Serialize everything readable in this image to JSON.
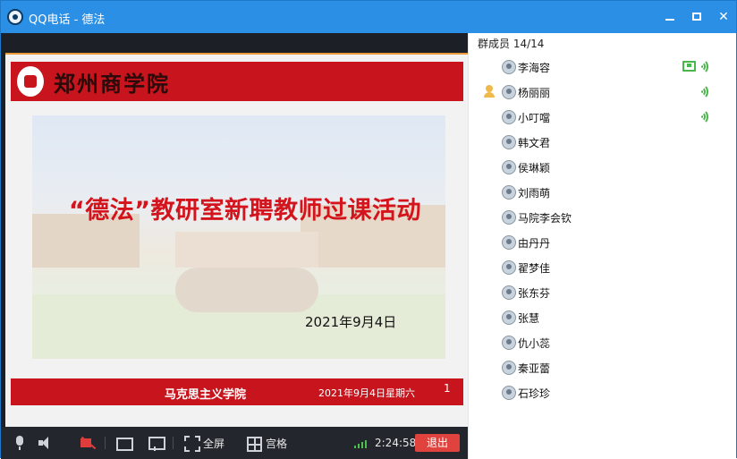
{
  "window": {
    "title": "QQ电话 - 德法"
  },
  "slide": {
    "school_name": "郑州商学院",
    "title": "“德法”教研室新聘教师过课活动",
    "date": "2021年9月4日",
    "footer_department": "马克思主义学院",
    "footer_date": "2021年9月4日星期六",
    "footer_page_mark": "1"
  },
  "toolbar": {
    "fullscreen_label": "全屏",
    "grid_label": "宫格",
    "call_duration": "2:24:58",
    "exit_label": "退出"
  },
  "members_panel": {
    "title": "群成员 14/14",
    "members": [
      {
        "name": "李海容",
        "sharing_screen": true,
        "speaking": true
      },
      {
        "name": "杨丽丽",
        "host": true,
        "speaking": true
      },
      {
        "name": "小叮噹",
        "speaking": true
      },
      {
        "name": "韩文君"
      },
      {
        "name": "侯琳颖"
      },
      {
        "name": "刘雨萌"
      },
      {
        "name": "马院李会钦"
      },
      {
        "name": "由丹丹"
      },
      {
        "name": "翟梦佳"
      },
      {
        "name": "张东芬"
      },
      {
        "name": "张慧"
      },
      {
        "name": "仇小蕊"
      },
      {
        "name": "秦亚蕾"
      },
      {
        "name": "石珍珍"
      }
    ]
  },
  "colors": {
    "title_bar": "#2b8fe6",
    "slide_red": "#c8141c",
    "exit_button": "#e0433d",
    "status_green": "#49b649"
  }
}
